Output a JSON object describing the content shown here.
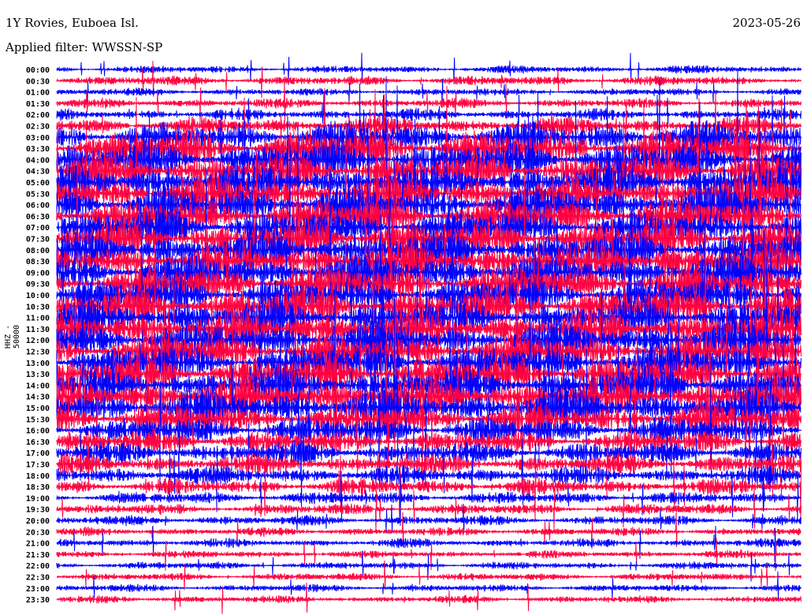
{
  "header": {
    "station": "1Y Rovies, Euboea Isl.",
    "filter": "Applied filter: WWSSN-SP",
    "date": "2023-05-26"
  },
  "chart_data": {
    "type": "line",
    "title": "1Y Rovies, Euboea Isl.",
    "subtitle": "Applied filter: WWSSN-SP",
    "ylabel": "HHZ - 50000",
    "xlabel": "",
    "colors": {
      "hour": "#0000ff",
      "half_hour": "#ff0040"
    },
    "row_labels": [
      "00:00",
      "00:30",
      "01:00",
      "01:30",
      "02:00",
      "02:30",
      "03:00",
      "03:30",
      "04:00",
      "04:30",
      "05:00",
      "05:30",
      "06:00",
      "06:30",
      "07:00",
      "07:30",
      "08:00",
      "08:30",
      "09:00",
      "09:30",
      "10:00",
      "10:30",
      "11:00",
      "11:30",
      "12:00",
      "12:30",
      "13:00",
      "13:30",
      "14:00",
      "14:30",
      "15:00",
      "15:30",
      "16:00",
      "16:30",
      "17:00",
      "17:30",
      "18:00",
      "18:30",
      "19:00",
      "19:30",
      "20:00",
      "20:30",
      "21:00",
      "21:30",
      "22:00",
      "22:30",
      "23:00",
      "23:30"
    ],
    "relative_amplitude": [
      0.6,
      0.8,
      0.6,
      0.8,
      0.9,
      1.4,
      2.5,
      3,
      3,
      3,
      3,
      3,
      3,
      3,
      3,
      3,
      3,
      3,
      3,
      3,
      3,
      3,
      3,
      3,
      3,
      3,
      3,
      3,
      3,
      3,
      3,
      2.6,
      2.2,
      1.9,
      1.8,
      1.6,
      1.5,
      1.3,
      1.0,
      0.9,
      0.8,
      0.7,
      0.7,
      0.6,
      0.6,
      0.6,
      0.6,
      0.6
    ],
    "row_duration_minutes": 30
  }
}
